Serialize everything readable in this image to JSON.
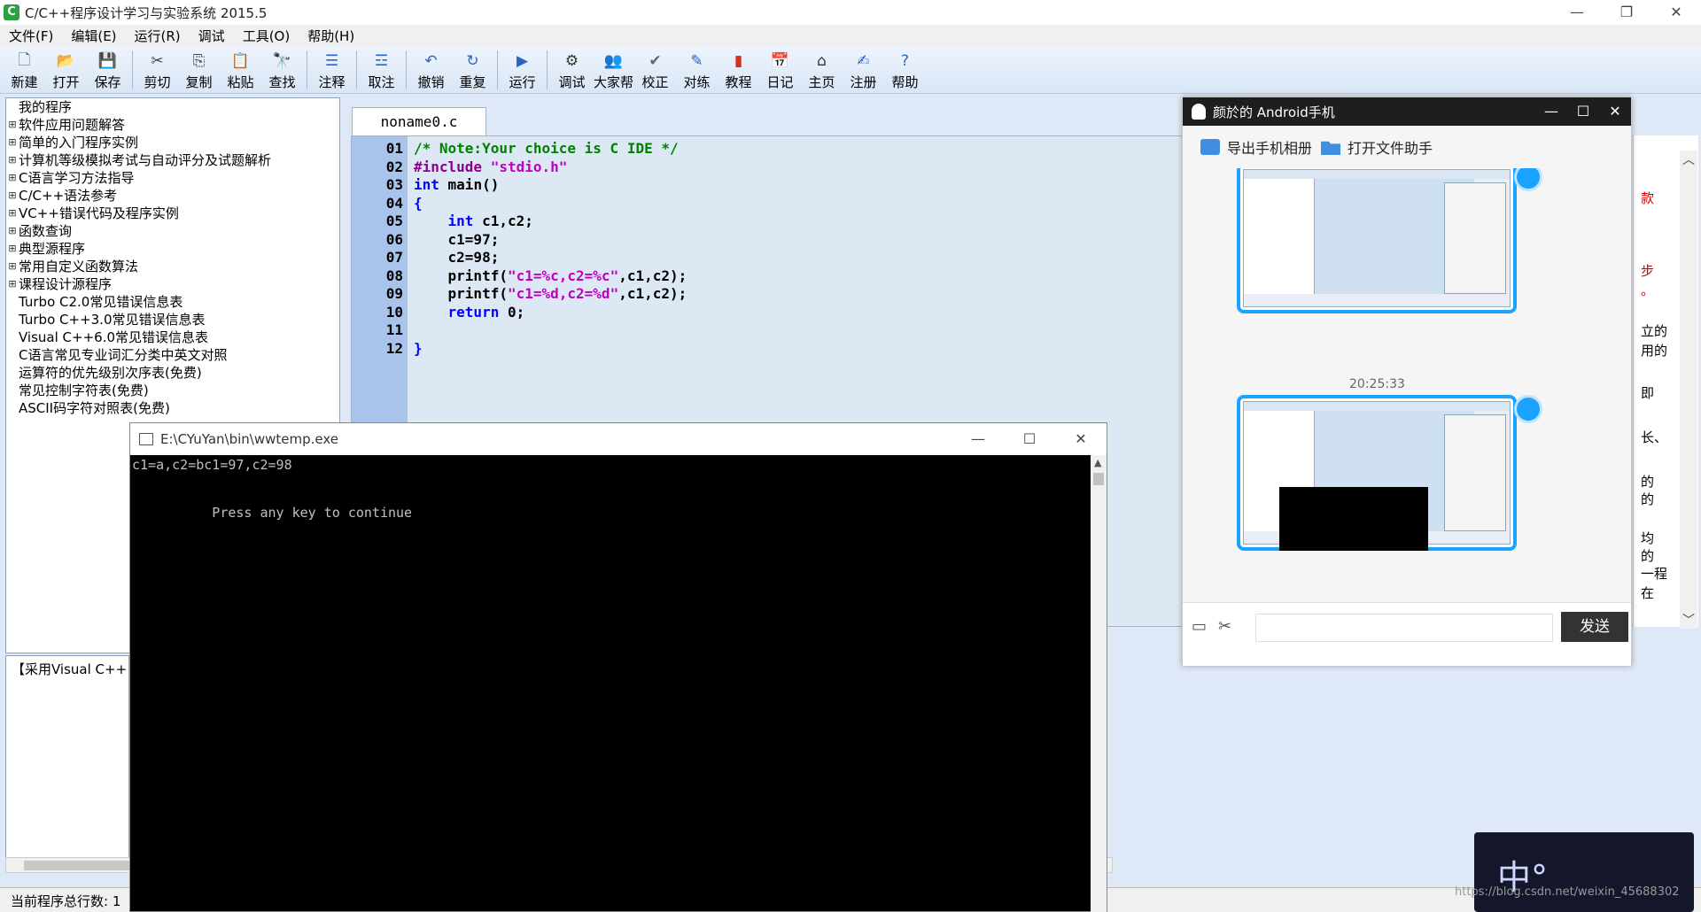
{
  "app": {
    "title": "C/C++程序设计学习与实验系统 2015.5",
    "icon_letter": "C",
    "menu": [
      "文件(F)",
      "编辑(E)",
      "运行(R)",
      "调试",
      "工具(O)",
      "帮助(H)"
    ]
  },
  "toolbar": {
    "groups": [
      [
        {
          "label": "新建",
          "icon": "new-file-icon",
          "glyph": "🗋",
          "color": "#2a64c8"
        },
        {
          "label": "打开",
          "icon": "open-folder-icon",
          "glyph": "📂",
          "color": "#d8a21a"
        },
        {
          "label": "保存",
          "icon": "save-icon",
          "glyph": "💾",
          "color": "#5b3ea8"
        }
      ],
      [
        {
          "label": "剪切",
          "icon": "cut-icon",
          "glyph": "✂",
          "color": "#444"
        },
        {
          "label": "复制",
          "icon": "copy-icon",
          "glyph": "⎘",
          "color": "#444"
        },
        {
          "label": "粘贴",
          "icon": "paste-icon",
          "glyph": "📋",
          "color": "#b07a2a"
        },
        {
          "label": "查找",
          "icon": "find-icon",
          "glyph": "🔭",
          "color": "#444"
        }
      ],
      [
        {
          "label": "注释",
          "icon": "comment-icon",
          "glyph": "☰",
          "color": "#2a64c8"
        }
      ],
      [
        {
          "label": "取注",
          "icon": "uncomment-icon",
          "glyph": "☲",
          "color": "#2a64c8"
        }
      ],
      [
        {
          "label": "撤销",
          "icon": "undo-icon",
          "glyph": "↶",
          "color": "#2a64c8"
        },
        {
          "label": "重复",
          "icon": "redo-icon",
          "glyph": "↻",
          "color": "#2a64c8"
        }
      ],
      [
        {
          "label": "运行",
          "icon": "run-icon",
          "glyph": "▶",
          "color": "#2a64c8"
        }
      ],
      [
        {
          "label": "调试",
          "icon": "debug-icon",
          "glyph": "⚙",
          "color": "#333"
        },
        {
          "label": "大家帮",
          "icon": "community-icon",
          "glyph": "👥",
          "color": "#c06020"
        },
        {
          "label": "校正",
          "icon": "check-icon",
          "glyph": "✔",
          "color": "#666"
        },
        {
          "label": "对练",
          "icon": "practice-icon",
          "glyph": "✎",
          "color": "#2a64c8"
        },
        {
          "label": "教程",
          "icon": "tutorial-icon",
          "glyph": "▮",
          "color": "#d03020"
        },
        {
          "label": "日记",
          "icon": "diary-icon",
          "glyph": "📅",
          "color": "#d03020"
        },
        {
          "label": "主页",
          "icon": "home-icon",
          "glyph": "⌂",
          "color": "#333"
        },
        {
          "label": "注册",
          "icon": "register-icon",
          "glyph": "✍",
          "color": "#2a64c8"
        },
        {
          "label": "帮助",
          "icon": "help-icon",
          "glyph": "?",
          "color": "#2a64c8"
        }
      ]
    ]
  },
  "tree": {
    "items": [
      {
        "label": "我的程序",
        "expander": ""
      },
      {
        "label": "软件应用问题解答",
        "expander": "⊞"
      },
      {
        "label": "简单的入门程序实例",
        "expander": "⊞"
      },
      {
        "label": "计算机等级模拟考试与自动评分及试题解析",
        "expander": "⊞"
      },
      {
        "label": "C语言学习方法指导",
        "expander": "⊞"
      },
      {
        "label": "C/C++语法参考",
        "expander": "⊞"
      },
      {
        "label": "VC++错误代码及程序实例",
        "expander": "⊞"
      },
      {
        "label": "函数查询",
        "expander": "⊞"
      },
      {
        "label": "典型源程序",
        "expander": "⊞"
      },
      {
        "label": "常用自定义函数算法",
        "expander": "⊞"
      },
      {
        "label": "课程设计源程序",
        "expander": "⊞"
      },
      {
        "label": "Turbo C2.0常见错误信息表",
        "expander": ""
      },
      {
        "label": "Turbo C++3.0常见错误信息表",
        "expander": ""
      },
      {
        "label": "Visual C++6.0常见错误信息表",
        "expander": ""
      },
      {
        "label": "C语言常见专业词汇分类中英文对照",
        "expander": ""
      },
      {
        "label": "运算符的优先级别次序表(免费)",
        "expander": ""
      },
      {
        "label": "常见控制字符表(免费)",
        "expander": ""
      },
      {
        "label": "ASCII码字符对照表(免费)",
        "expander": ""
      }
    ]
  },
  "bottom_panel": {
    "text": "【采用Visual C++"
  },
  "status": {
    "line_count_label": "当前程序总行数:",
    "line_count_value": "1"
  },
  "editor": {
    "tab": "noname0.c",
    "lines": [
      {
        "n": "01",
        "tokens": [
          {
            "t": "/* Note:Your choice is C IDE */",
            "c": "c-cmt"
          }
        ]
      },
      {
        "n": "02",
        "tokens": [
          {
            "t": "#include ",
            "c": "c-pp"
          },
          {
            "t": "\"stdio.h\"",
            "c": "c-str"
          }
        ]
      },
      {
        "n": "03",
        "tokens": [
          {
            "t": "int",
            "c": "c-kw"
          },
          {
            "t": " main()",
            "c": ""
          }
        ]
      },
      {
        "n": "04",
        "tokens": [
          {
            "t": "{",
            "c": "c-kw"
          }
        ]
      },
      {
        "n": "05",
        "tokens": [
          {
            "t": "    int",
            "c": "c-kw"
          },
          {
            "t": " c1,c2;",
            "c": ""
          }
        ]
      },
      {
        "n": "06",
        "tokens": [
          {
            "t": "    c1=97;",
            "c": ""
          }
        ]
      },
      {
        "n": "07",
        "tokens": [
          {
            "t": "    c2=98;",
            "c": ""
          }
        ]
      },
      {
        "n": "08",
        "tokens": [
          {
            "t": "    printf(",
            "c": ""
          },
          {
            "t": "\"c1=%c,c2=%c\"",
            "c": "c-str"
          },
          {
            "t": ",c1,c2);",
            "c": ""
          }
        ]
      },
      {
        "n": "09",
        "tokens": [
          {
            "t": "    printf(",
            "c": ""
          },
          {
            "t": "\"c1=%d,c2=%d\"",
            "c": "c-str"
          },
          {
            "t": ",c1,c2);",
            "c": ""
          }
        ]
      },
      {
        "n": "10",
        "tokens": [
          {
            "t": "    return",
            "c": "c-kw"
          },
          {
            "t": " 0;",
            "c": ""
          }
        ]
      },
      {
        "n": "11",
        "tokens": []
      },
      {
        "n": "12",
        "tokens": [
          {
            "t": "}",
            "c": "c-kw"
          }
        ]
      }
    ]
  },
  "console": {
    "title": "E:\\CYuYan\\bin\\wwtemp.exe",
    "output": "c1=a,c2=bc1=97,c2=98\n\n\n          Press any key to continue"
  },
  "qq": {
    "title": "颜於的 Android手机",
    "export_album": "导出手机相册",
    "open_file_helper": "打开文件助手",
    "time": "20:25:33",
    "send": "发送"
  },
  "right_strip": {
    "fragments": [
      "款",
      "步",
      "。",
      "立的",
      "用的",
      "即",
      "长、",
      "的",
      "的",
      "均",
      "的",
      "一程",
      "在"
    ]
  },
  "watermark": "https://blog.csdn.net/weixin_45688302"
}
